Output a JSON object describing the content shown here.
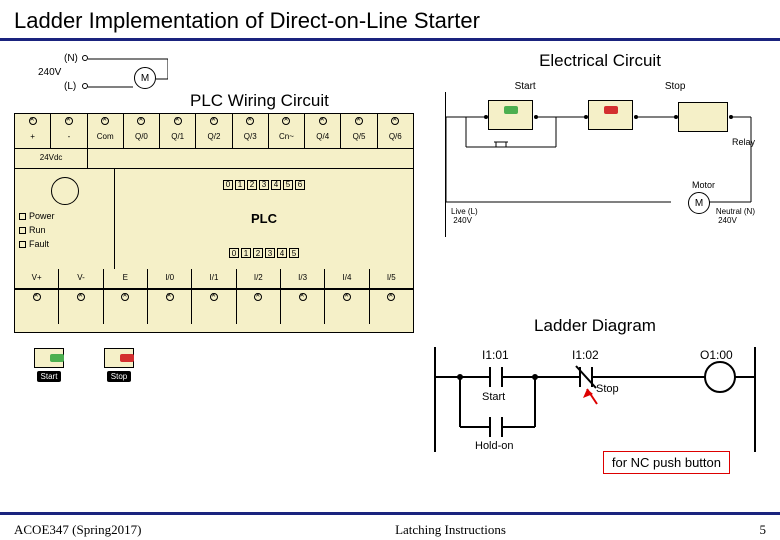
{
  "title": "Ladder Implementation of Direct-on-Line Starter",
  "plc": {
    "wiring_label": "PLC Wiring Circuit",
    "supply_n": "(N)",
    "supply_v": "240V",
    "supply_l": "(L)",
    "motor": "M",
    "top_terminals": [
      "+",
      "-",
      "Com",
      "Q/0",
      "Q/1",
      "Q/2",
      "Q/3",
      "Cn~",
      "Q/4",
      "Q/5",
      "Q/6"
    ],
    "supply_24": "24Vdc",
    "leds": {
      "power": "Power",
      "run": "Run",
      "fault": "Fault"
    },
    "name": "PLC",
    "inputs_label_row": [
      "V+",
      "V-",
      "E",
      "I/0",
      "I/1",
      "I/2",
      "I/3",
      "I/4",
      "I/5"
    ],
    "bottom_spare": "",
    "buttons": {
      "start": "Start",
      "stop": "Stop"
    }
  },
  "electrical": {
    "title": "Electrical Circuit",
    "start": "Start",
    "stop": "Stop",
    "relay": "Relay",
    "motor": "Motor",
    "m": "M",
    "live": "Live (L)\n 240V",
    "neutral": "Neutral (N)\n 240V"
  },
  "ladder": {
    "title": "Ladder Diagram",
    "i1": "I1:01",
    "i2": "I1:02",
    "o1": "O1:00",
    "start": "Start",
    "stop": "Stop",
    "holdon": "Hold-on"
  },
  "note": "for NC push button",
  "footer": {
    "left": "ACOE347 (Spring2017)",
    "center": "Latching Instructions",
    "right": "5"
  }
}
